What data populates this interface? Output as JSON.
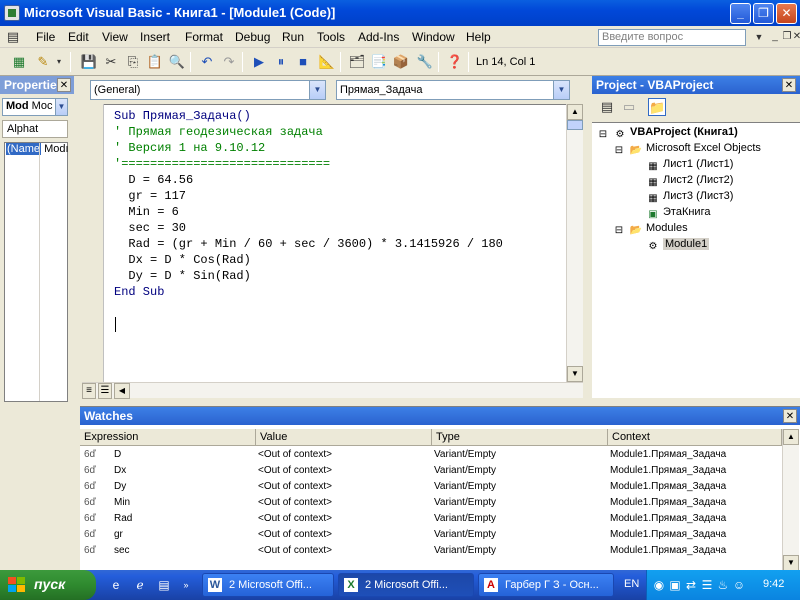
{
  "window": {
    "title": "Microsoft Visual Basic - Книга1 - [Module1 (Code)]",
    "minimize": "_",
    "restore": "❐",
    "close": "✕"
  },
  "menu": {
    "items": [
      "File",
      "Edit",
      "View",
      "Insert",
      "Format",
      "Debug",
      "Run",
      "Tools",
      "Add-Ins",
      "Window",
      "Help"
    ],
    "help_placeholder": "Введите вопрос"
  },
  "toolbar": {
    "position": "Ln 14, Col 1"
  },
  "properties": {
    "title": "Properties",
    "object": "Mod",
    "object_type": "Moc",
    "tab": "Alphat",
    "row_name": "(Name",
    "row_value": "Modı"
  },
  "code": {
    "object_combo": "(General)",
    "proc_combo": "Прямая_Задача",
    "lines": [
      {
        "t": "Sub Прямая_Задача()",
        "c": "kw"
      },
      {
        "t": "' Прямая геодезическая задача",
        "c": "cm"
      },
      {
        "t": "' Версия 1 на 9.10.12",
        "c": "cm"
      },
      {
        "t": "'=============================",
        "c": "cm"
      },
      {
        "t": "  D = 64.56",
        "c": ""
      },
      {
        "t": "  gr = 117",
        "c": ""
      },
      {
        "t": "  Min = 6",
        "c": ""
      },
      {
        "t": "  sec = 30",
        "c": ""
      },
      {
        "t": "  Rad = (gr + Min / 60 + sec / 3600) * 3.1415926 / 180",
        "c": ""
      },
      {
        "t": "  Dx = D * Cos(Rad)",
        "c": ""
      },
      {
        "t": "  Dy = D * Sin(Rad)",
        "c": ""
      },
      {
        "t": "End Sub",
        "c": "kw"
      }
    ]
  },
  "project": {
    "title": "Project - VBAProject",
    "root": "VBAProject (Книга1)",
    "folder_objects": "Microsoft Excel Objects",
    "sheet1": "Лист1 (Лист1)",
    "sheet2": "Лист2 (Лист2)",
    "sheet3": "Лист3 (Лист3)",
    "thisbook": "ЭтаКнига",
    "folder_modules": "Modules",
    "module1": "Module1"
  },
  "watches": {
    "title": "Watches",
    "headers": [
      "Expression",
      "Value",
      "Type",
      "Context"
    ],
    "rows": [
      [
        "D",
        "<Out of context>",
        "Variant/Empty",
        "Module1.Прямая_Задача"
      ],
      [
        "Dx",
        "<Out of context>",
        "Variant/Empty",
        "Module1.Прямая_Задача"
      ],
      [
        "Dy",
        "<Out of context>",
        "Variant/Empty",
        "Module1.Прямая_Задача"
      ],
      [
        "Min",
        "<Out of context>",
        "Variant/Empty",
        "Module1.Прямая_Задача"
      ],
      [
        "Rad",
        "<Out of context>",
        "Variant/Empty",
        "Module1.Прямая_Задача"
      ],
      [
        "gr",
        "<Out of context>",
        "Variant/Empty",
        "Module1.Прямая_Задача"
      ],
      [
        "sec",
        "<Out of context>",
        "Variant/Empty",
        "Module1.Прямая_Задача"
      ]
    ],
    "row_icon": "6ď"
  },
  "taskbar": {
    "start": "пуск",
    "tasks": [
      "2 Microsoft Offi...",
      "2 Microsoft Offi...",
      "Гарбер Г З - Осн..."
    ],
    "lang": "EN",
    "clock": "9:42"
  }
}
